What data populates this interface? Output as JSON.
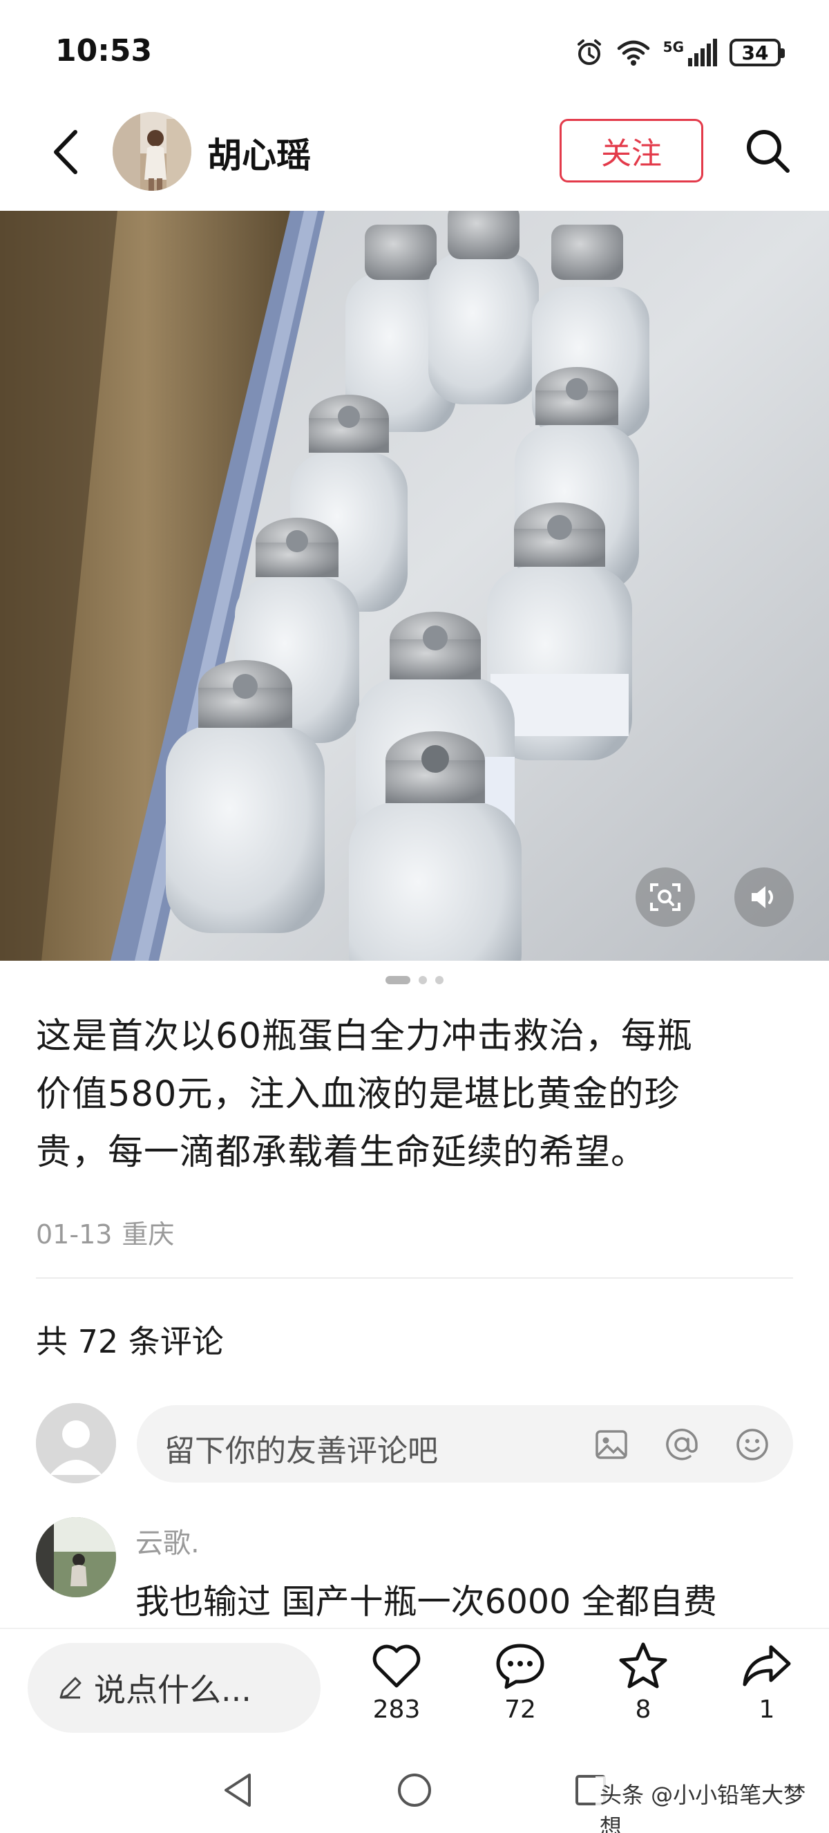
{
  "status_bar": {
    "time": "10:53",
    "signal_label": "5G",
    "battery": "34",
    "icons": [
      "alarm-icon",
      "wifi-icon",
      "signal-icon",
      "battery-icon"
    ]
  },
  "header": {
    "username": "胡心瑶",
    "follow_label": "关注"
  },
  "post": {
    "image_count": 3,
    "active_image": 1,
    "text_lines": [
      "这是首次以60瓶蛋白全力冲击救治，每瓶",
      "价值580元，注入血液的是堪比黄金的珍",
      "贵，每一滴都承载着生命延续的希望。"
    ],
    "date": "01-13",
    "location": "重庆"
  },
  "comments": {
    "count_label": "共 72 条评论",
    "input_placeholder": "留下你的友善评论吧",
    "items": [
      {
        "author": "云歌.",
        "text": "我也输过 国产十瓶一次6000 全都自费"
      }
    ]
  },
  "action_bar": {
    "say_placeholder": "说点什么...",
    "likes": "283",
    "comments": "72",
    "favorites": "8",
    "shares": "1"
  },
  "watermark": "头条 @小小铅笔大梦想",
  "colors": {
    "accent": "#e33a4a",
    "muted_text": "#9a9a9a",
    "input_bg": "#f3f3f3"
  }
}
